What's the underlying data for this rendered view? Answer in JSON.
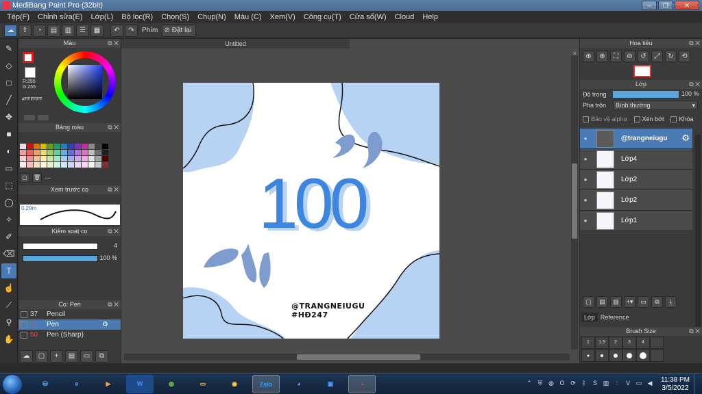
{
  "window": {
    "title": "MediBang Paint Pro (32bit)",
    "controls": [
      "–",
      "❐",
      "✕"
    ]
  },
  "menu": [
    "Tệp(F)",
    "Chỉnh sửa(E)",
    "Lớp(L)",
    "Bộ lọc(R)",
    "Chọn(S)",
    "Chụp(N)",
    "Màu (C)",
    "Xem(V)",
    "Công cụ(T)",
    "Cửa sổ(W)",
    "Cloud",
    "Help"
  ],
  "toolbar": {
    "phim_label": "Phím",
    "reset_label": "Đặt lại"
  },
  "color_panel": {
    "title": "Màu",
    "rgb": [
      "R:255",
      "G:255"
    ],
    "hex": "#FFFFFF"
  },
  "swatch_panel": {
    "title": "Bảng màu",
    "more": "---",
    "colors": [
      "#e8e0e0",
      "#d01010",
      "#e07000",
      "#d0c000",
      "#60a020",
      "#20a060",
      "#2080c0",
      "#3040c0",
      "#8030c0",
      "#c030a0",
      "#8a8a8a",
      "#404040",
      "#000000",
      "#f0a0a0",
      "#f06060",
      "#f0a060",
      "#f0e070",
      "#a0d060",
      "#60d0a0",
      "#60b0e0",
      "#6070e0",
      "#b070e0",
      "#e070c0",
      "#c0c0c0",
      "#707070",
      "#202020",
      "#f8d0d0",
      "#f09090",
      "#f0c090",
      "#f8f0a0",
      "#c8e8a0",
      "#a0e8c8",
      "#a0d0f0",
      "#a0a8f0",
      "#d0a8f0",
      "#f0a8e0",
      "#e0e0e0",
      "#a0a0a0",
      "#500000",
      "#ffe8e8",
      "#fbb8b8",
      "#f8dcc0",
      "#fffad0",
      "#e0f4cc",
      "#cdf4e4",
      "#cfe8f8",
      "#cfd4f8",
      "#e8d4f8",
      "#f8d4f0",
      "#f4f4f4",
      "#c8c8c8",
      "#803030"
    ],
    "layout": "13 columns x 4 rows"
  },
  "preview_panel": {
    "title": "Xem trước cọ",
    "size": "0.29m"
  },
  "brush_control": {
    "title": "Kiểm soát cọ",
    "size_value": "4",
    "opacity_value": "100 %"
  },
  "brush_panel": {
    "title": "Cọ: Pen",
    "items": [
      {
        "size": "37",
        "name": "Pencil",
        "selected": false
      },
      {
        "size": "4",
        "name": "Pen",
        "selected": true
      },
      {
        "size": "50",
        "name": "Pen (Sharp)",
        "selected": false
      }
    ]
  },
  "canvas": {
    "tab_title": "Untitled",
    "close": "×",
    "art_number": "100",
    "art_tag1": "@TRANGNEIUGU",
    "art_tag2": "#HĐ247",
    "colors": {
      "blob": "#b7d3f4",
      "accent": "#3d86e0",
      "drop": "#7f9ccf"
    }
  },
  "navigator": {
    "title": "Hoa tiêu"
  },
  "layers": {
    "title": "Lớp",
    "opacity_label": "Độ trong",
    "opacity_value": "100 %",
    "opacity_fraction": 1.0,
    "blend_label": "Pha trộn",
    "blend_value": "Bình thường",
    "protect_alpha": "Bảo vệ alpha",
    "clipping": "Xén bớt",
    "lock": "Khóa",
    "items": [
      {
        "name": "@trangneiugu",
        "selected": true
      },
      {
        "name": "Lớp4",
        "selected": false
      },
      {
        "name": "Lớp2",
        "selected": false
      },
      {
        "name": "Lớp2",
        "selected": false
      },
      {
        "name": "Lớp1",
        "selected": false
      }
    ],
    "tabs": [
      "Lớp",
      "Reference"
    ]
  },
  "brush_size": {
    "title": "Brush Size",
    "sizes": [
      "1",
      "1.5",
      "2",
      "3",
      "4",
      ""
    ]
  },
  "taskbar": {
    "apps": [
      "W",
      "Zalo"
    ],
    "time": "11:38 PM",
    "date": "3/5/2022"
  }
}
